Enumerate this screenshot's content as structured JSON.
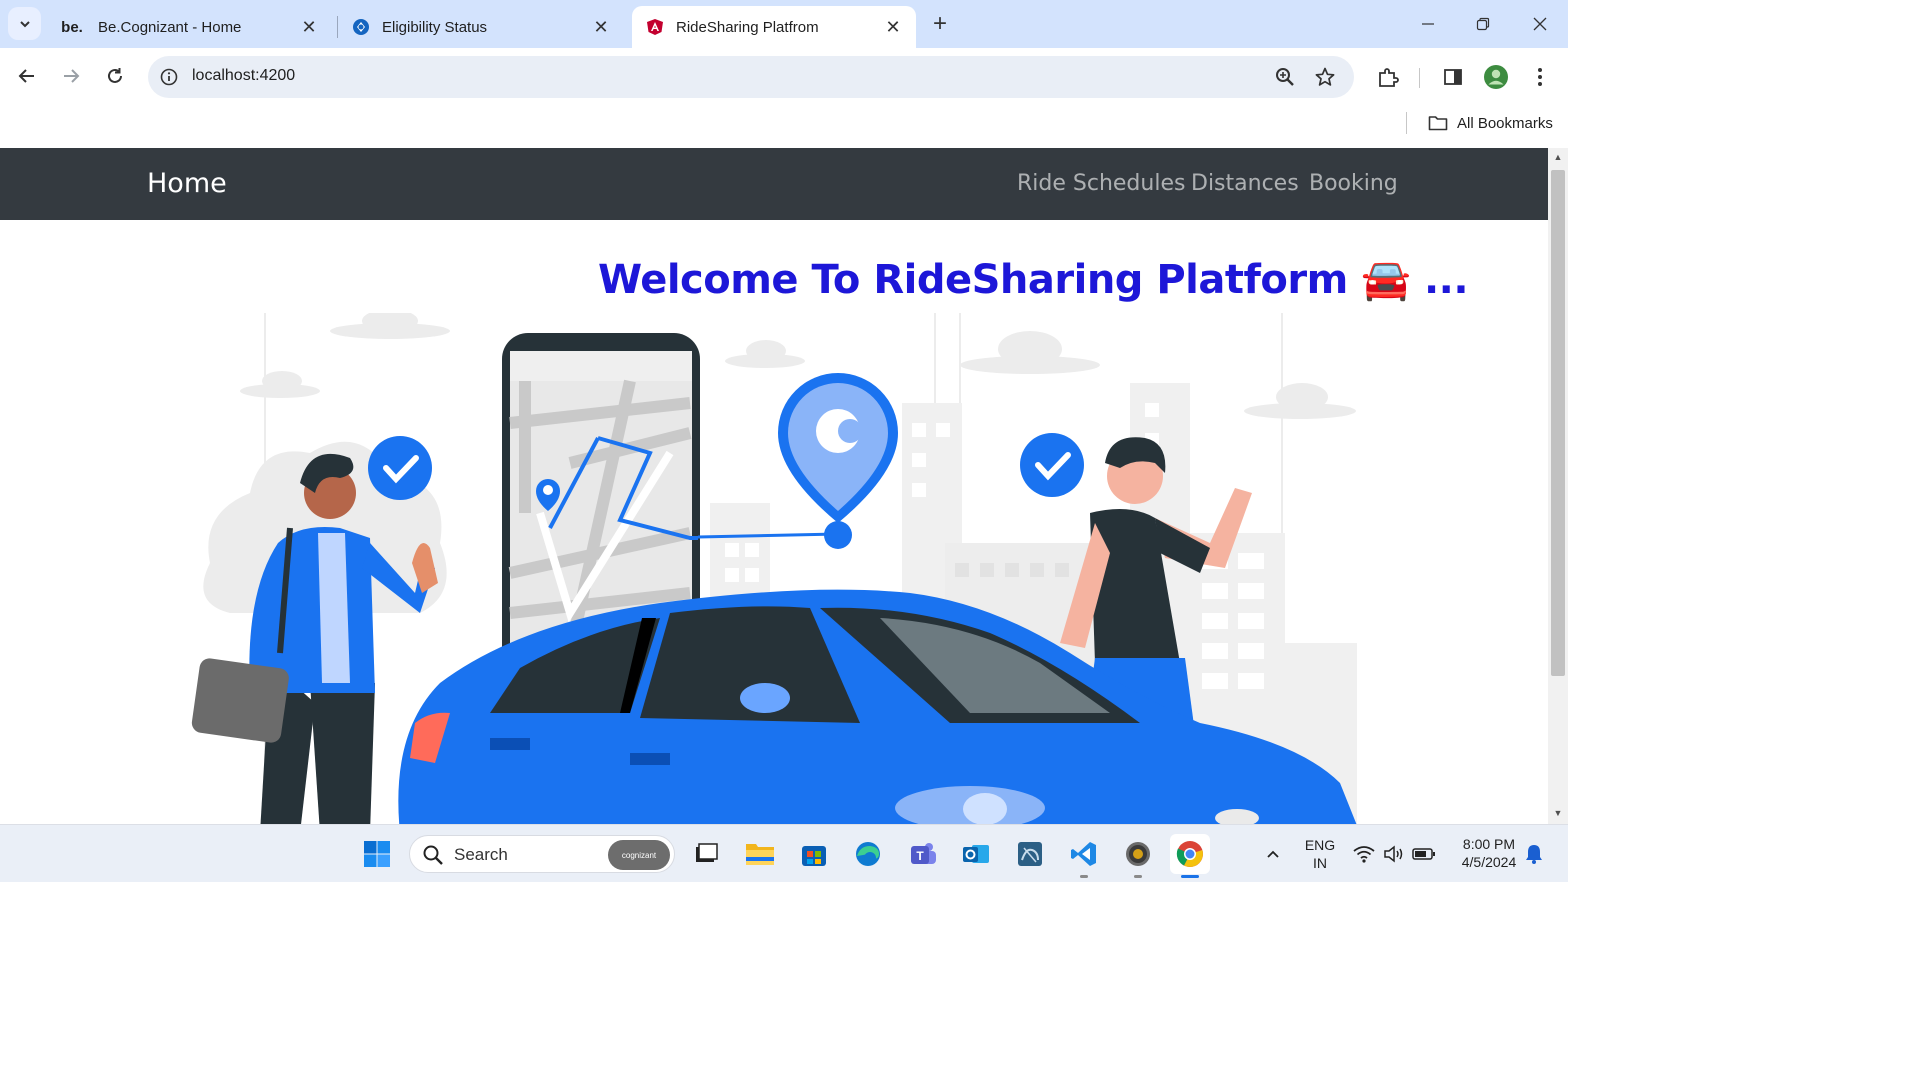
{
  "browser": {
    "tabs": [
      {
        "favicon": "be.",
        "title": "Be.Cognizant - Home",
        "active": false
      },
      {
        "favicon": "eligibility-favicon",
        "title": "Eligibility Status",
        "active": false
      },
      {
        "favicon": "angular-favicon",
        "title": "RideSharing Platfrom",
        "active": true
      }
    ],
    "url": "localhost:4200",
    "bookmarks_label": "All Bookmarks"
  },
  "app": {
    "brand": "Home",
    "nav_links": [
      "Ride Schedules",
      "Distances",
      "Booking"
    ],
    "welcome": "Welcome To RideSharing Platform 🚘 ...",
    "colors": {
      "navbar": "#343a40",
      "welcome": "#1d17d8",
      "accent": "#1a73f0"
    }
  },
  "taskbar": {
    "search_label": "Search",
    "search_badge": "cognizant",
    "lang_line1": "ENG",
    "lang_line2": "IN",
    "time": "8:00 PM",
    "date": "4/5/2024",
    "apps": [
      "windows-start-icon",
      "task-view-icon",
      "file-explorer-icon",
      "microsoft-store-icon",
      "edge-icon",
      "teams-icon",
      "outlook-icon",
      "mysql-workbench-icon",
      "vscode-icon",
      "app-icon",
      "chrome-icon"
    ]
  }
}
